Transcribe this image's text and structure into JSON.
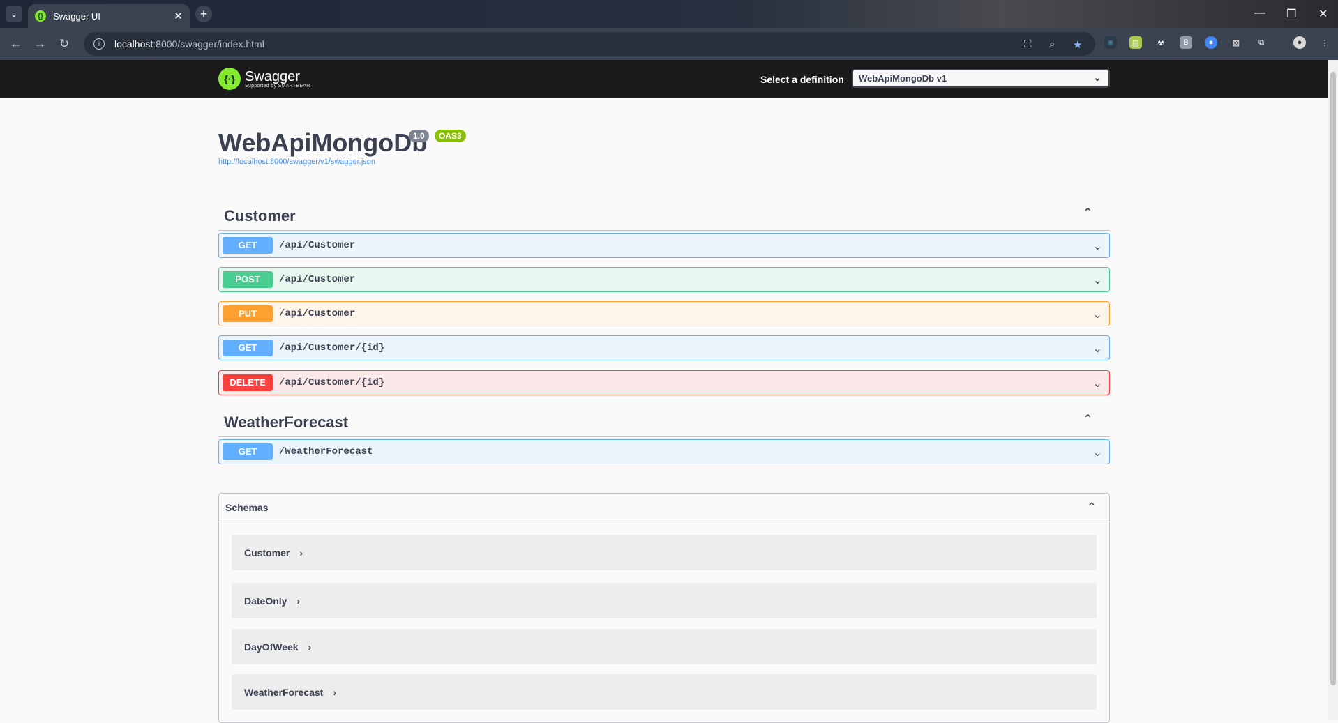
{
  "browser": {
    "tab_title": "Swagger UI",
    "url_host": "localhost",
    "url_rest": ":8000/swagger/index.html"
  },
  "swagger": {
    "logo_name": "Swagger",
    "logo_sub": "Supported by SMARTBEAR",
    "definition_label": "Select a definition",
    "definition_value": "WebApiMongoDb v1"
  },
  "info": {
    "title": "WebApiMongoDb",
    "version": "1.0",
    "oas": "OAS3",
    "spec_url": "http://localhost:8000/swagger/v1/swagger.json"
  },
  "tags": [
    {
      "name": "Customer",
      "operations": [
        {
          "method": "GET",
          "path": "/api/Customer"
        },
        {
          "method": "POST",
          "path": "/api/Customer"
        },
        {
          "method": "PUT",
          "path": "/api/Customer"
        },
        {
          "method": "GET",
          "path": "/api/Customer/{id}"
        },
        {
          "method": "DELETE",
          "path": "/api/Customer/{id}"
        }
      ]
    },
    {
      "name": "WeatherForecast",
      "operations": [
        {
          "method": "GET",
          "path": "/WeatherForecast"
        }
      ]
    }
  ],
  "schemas": {
    "label": "Schemas",
    "models": [
      "Customer",
      "DateOnly",
      "DayOfWeek",
      "WeatherForecast"
    ]
  },
  "colors": {
    "get": "#61affe",
    "post": "#49cc90",
    "put": "#fca130",
    "delete": "#f93e3e",
    "swagger_green": "#85ea2d"
  }
}
